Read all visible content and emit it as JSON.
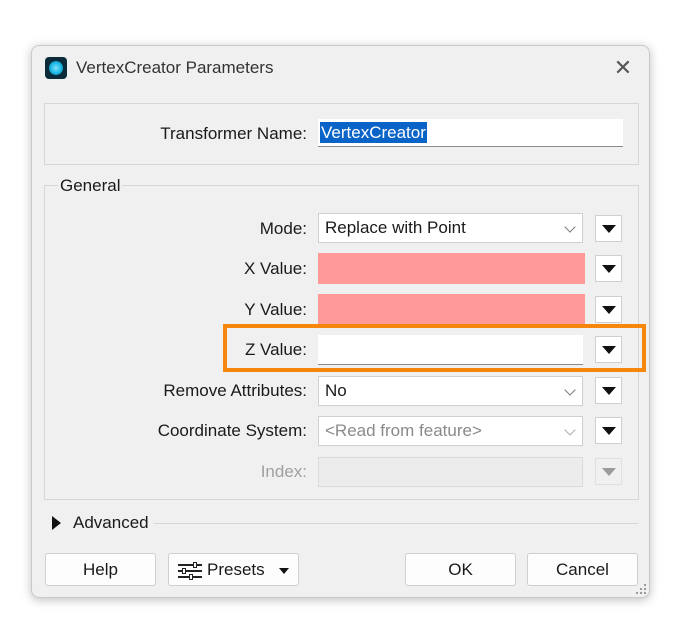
{
  "window": {
    "title": "VertexCreator Parameters",
    "icon": "app-icon",
    "close_icon": "close-icon"
  },
  "transformer": {
    "label": "Transformer Name:",
    "value": "VertexCreator"
  },
  "general": {
    "group_label": "General",
    "mode": {
      "label": "Mode:",
      "value": "Replace with Point"
    },
    "x_value": {
      "label": "X Value:",
      "value": ""
    },
    "y_value": {
      "label": "Y Value:",
      "value": ""
    },
    "z_value": {
      "label": "Z Value:",
      "value": ""
    },
    "remove_attributes": {
      "label": "Remove Attributes:",
      "value": "No"
    },
    "coordinate_system": {
      "label": "Coordinate System:",
      "value": "<Read from feature>"
    },
    "index": {
      "label": "Index:",
      "value": ""
    }
  },
  "advanced": {
    "label": "Advanced"
  },
  "buttons": {
    "help": "Help",
    "presets": "Presets",
    "ok": "OK",
    "cancel": "Cancel"
  },
  "colors": {
    "required_field": "#ff9a99",
    "highlight": "#f7860d",
    "selection": "#0a64c8"
  }
}
